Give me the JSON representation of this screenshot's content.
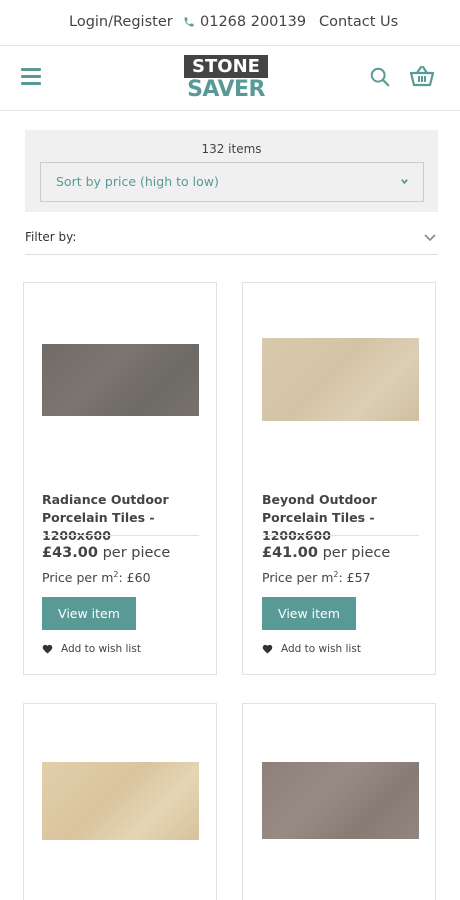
{
  "topbar": {
    "login": "Login/Register",
    "phone": "01268 200139",
    "contact": "Contact Us"
  },
  "header": {
    "logo_top": "STONE",
    "logo_bottom": "SAVER",
    "icons": [
      "menu-icon",
      "search-icon",
      "basket-icon"
    ]
  },
  "listing": {
    "items_count": "132 items",
    "sort_selected": "Sort by price (high to low)",
    "filter_label": "Filter by:"
  },
  "products": [
    {
      "name": "Radiance Outdoor Porcelain Tiles - 1200x600",
      "price": "£43.00",
      "price_unit": "per piece",
      "ppm_label": "Price per m",
      "ppm_sup": "2",
      "ppm_value": ": £60",
      "button": "View item",
      "wish": "Add to wish list"
    },
    {
      "name": "Beyond Outdoor Porcelain Tiles - 1200x600",
      "price": "£41.00",
      "price_unit": "per piece",
      "ppm_label": "Price per m",
      "ppm_sup": "2",
      "ppm_value": ": £57",
      "button": "View item",
      "wish": "Add to wish list"
    },
    {
      "name": ""
    },
    {
      "name": ""
    }
  ],
  "colors": {
    "accent": "#5a9a96",
    "logo_dark": "#444444"
  }
}
